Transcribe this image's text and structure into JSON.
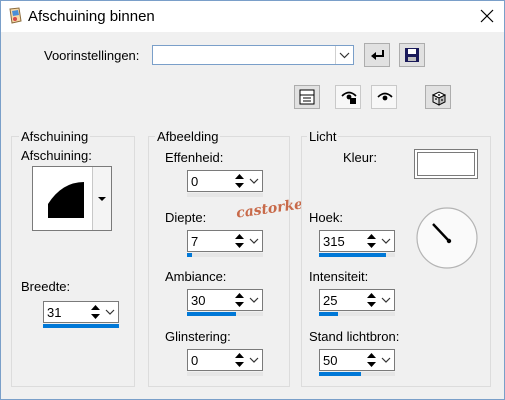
{
  "window": {
    "title": "Afschuining binnen"
  },
  "presets": {
    "label": "Voorinstellingen:",
    "value": ""
  },
  "bevel": {
    "group_title": "Afschuining",
    "shape_label": "Afschuining:",
    "width_label": "Breedte:",
    "width_value": "31",
    "width_fraction": 1.0
  },
  "image": {
    "group_title": "Afbeelding",
    "smoothness_label": "Effenheid:",
    "smoothness_value": "0",
    "smoothness_fraction": 0.0,
    "depth_label": "Diepte:",
    "depth_value": "7",
    "depth_fraction": 0.07,
    "ambience_label": "Ambiance:",
    "ambience_value": "30",
    "ambience_fraction": 0.65,
    "shininess_label": "Glinstering:",
    "shininess_value": "0",
    "shininess_fraction": 0.0
  },
  "light": {
    "group_title": "Licht",
    "color_label": "Kleur:",
    "color_value": "#ffffff",
    "angle_label": "Hoek:",
    "angle_value": "315",
    "angle_fraction": 0.875,
    "intensity_label": "Intensiteit:",
    "intensity_value": "25",
    "intensity_fraction": 0.25,
    "elevation_label": "Stand lichtbron:",
    "elevation_value": "50",
    "elevation_fraction": 0.55
  },
  "watermark": "castorke",
  "colors": {
    "accent": "#0078d7",
    "border_blue": "#7a9fc9"
  },
  "icons": [
    "app-icon",
    "close-icon",
    "reset-icon",
    "save-icon",
    "list-icon",
    "proof-icon",
    "eye-icon",
    "dice-icon",
    "chevron-down-icon"
  ]
}
